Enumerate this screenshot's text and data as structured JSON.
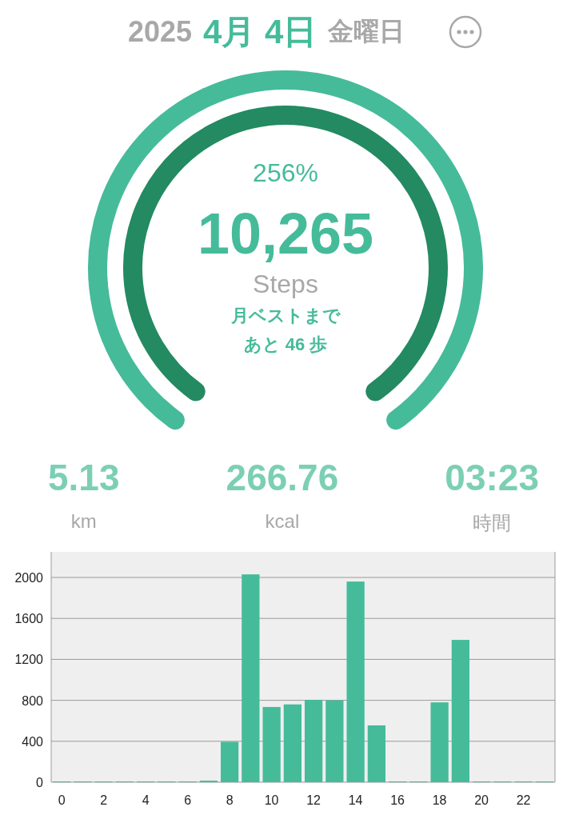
{
  "header": {
    "year": "2025",
    "date": "4月 4日",
    "weekday": "金曜日"
  },
  "ring": {
    "percent": "256%",
    "steps": "10,265",
    "unit": "Steps",
    "note_line1": "月ベストまで",
    "note_line2": "あと 46 歩"
  },
  "stats": [
    {
      "value": "5.13",
      "unit": "km"
    },
    {
      "value": "266.76",
      "unit": "kcal"
    },
    {
      "value": "03:23",
      "unit": "時間"
    }
  ],
  "chart_data": {
    "type": "bar",
    "x": [
      0,
      1,
      2,
      3,
      4,
      5,
      6,
      7,
      8,
      9,
      10,
      11,
      12,
      13,
      14,
      15,
      16,
      17,
      18,
      19,
      20,
      21,
      22,
      23
    ],
    "values": [
      0,
      0,
      0,
      0,
      0,
      0,
      0,
      15,
      395,
      2030,
      735,
      760,
      805,
      800,
      1960,
      555,
      0,
      0,
      780,
      1390,
      5,
      0,
      0,
      0
    ],
    "xlim": [
      -0.5,
      23.5
    ],
    "ylim": [
      0,
      2250
    ],
    "yticks": [
      0,
      400,
      800,
      1200,
      1600,
      2000
    ],
    "xticks": [
      0,
      2,
      4,
      6,
      8,
      10,
      12,
      14,
      16,
      18,
      20,
      22
    ],
    "grid": true
  }
}
